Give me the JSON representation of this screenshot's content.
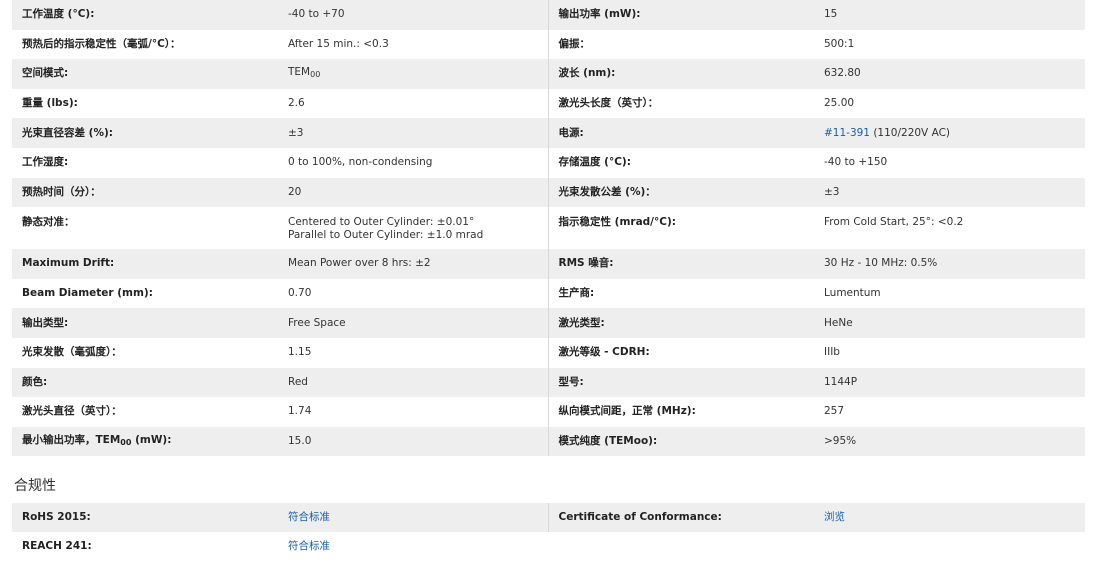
{
  "specs": [
    {
      "l1": "工作温度 (°C):",
      "v1": "-40 to +70",
      "l2": "输出功率 (mW):",
      "v2": "15"
    },
    {
      "l1": "预热后的指示稳定性（毫弧/°C）：",
      "v1": "After 15 min.: <0.3",
      "l2": "偏振：",
      "v2": "500:1"
    },
    {
      "l1": "空间模式:",
      "v1_main": "TEM",
      "v1_sub": "00",
      "l2": "波长 (nm):",
      "v2": "632.80"
    },
    {
      "l1": "重量 (lbs):",
      "v1": "2.6",
      "l2": "激光头长度（英寸）：",
      "v2": "25.00"
    },
    {
      "l1": "光束直径容差 (%):",
      "v1": "±3",
      "l2": "电源:",
      "v2_link": "#11-391",
      "v2_rest": " (110/220V AC)"
    },
    {
      "l1": "工作湿度:",
      "v1": "0 to 100%, non-condensing",
      "l2": "存储温度 (°C):",
      "v2": "-40 to +150"
    },
    {
      "l1": "预热时间（分）：",
      "v1": "20",
      "l2": "光束发散公差 (%)：",
      "v2": "±3"
    },
    {
      "l1": "静态对准：",
      "v1_line1": "Centered to Outer Cylinder: ±0.01°",
      "v1_line2": "Parallel to Outer Cylinder: ±1.0 mrad",
      "l2": "指示稳定性 (mrad/°C):",
      "v2": "From Cold Start, 25°: <0.2"
    },
    {
      "l1": "Maximum Drift:",
      "v1": "Mean Power over 8 hrs: ±2",
      "l2": "RMS 噪音:",
      "v2": "30 Hz - 10 MHz: 0.5%"
    },
    {
      "l1": "Beam Diameter (mm):",
      "v1": "0.70",
      "l2": "生产商:",
      "v2": "Lumentum"
    },
    {
      "l1": "输出类型:",
      "v1": "Free Space",
      "l2": "激光类型:",
      "v2": "HeNe"
    },
    {
      "l1": "光束发散（毫弧度）：",
      "v1": "1.15",
      "l2": "激光等级 - CDRH:",
      "v2": "IIIb"
    },
    {
      "l1": "颜色:",
      "v1": "Red",
      "l2": "型号:",
      "v2": "1144P"
    },
    {
      "l1": "激光头直径（英寸）：",
      "v1": "1.74",
      "l2": "纵向模式间距，正常 (MHz):",
      "v2": "257"
    },
    {
      "l1_main": "最小输出功率，TEM",
      "l1_sub": "00",
      "l1_tail": " (mW):",
      "v1": "15.0",
      "l2": "模式纯度 (TEMoo):",
      "v2": ">95%"
    }
  ],
  "compliance": {
    "title": "合规性",
    "rows": [
      {
        "l1": "RoHS 2015:",
        "v1": "符合标准",
        "l2": "Certificate of Conformance:",
        "v2": "浏览"
      },
      {
        "l1": "REACH 241:",
        "v1": "符合标准",
        "l2": "",
        "v2": ""
      }
    ]
  },
  "colors": {
    "link": "#1a5ea8",
    "shade": "#eeeeee",
    "label": "#222222"
  }
}
